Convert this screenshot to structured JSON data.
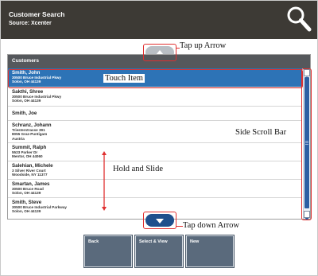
{
  "header": {
    "title": "Customer Search",
    "source": "Source: Xcenter",
    "search_icon": "search-icon"
  },
  "panel": {
    "title": "Customers"
  },
  "customers": [
    {
      "name": "Smith, John",
      "address": [
        "30500 Bruce Industrial Pkwy",
        "Solon, OH 44139"
      ],
      "selected": true
    },
    {
      "name": "Sakthi, Shree",
      "address": [
        "30500 Bruce Industrial Pkwy",
        "Solon, OH 44139"
      ],
      "selected": false
    },
    {
      "name": "Smith, Joe",
      "address": [],
      "selected": false
    },
    {
      "name": "Schranz, Johann",
      "address": [
        "Triesterstrasse 391",
        "8055 Graz-Puntigam",
        "Austria"
      ],
      "selected": false
    },
    {
      "name": "Summit, Ralph",
      "address": [
        "5523 Parker Dr",
        "Mentor, OH 44060"
      ],
      "selected": false
    },
    {
      "name": "Salehian, Michele",
      "address": [
        "3 Silver River Court",
        "Woodside, NY 11377"
      ],
      "selected": false
    },
    {
      "name": "Smartan, James",
      "address": [
        "30500 Bruce Road",
        "Solon, OH 44139"
      ],
      "selected": false
    },
    {
      "name": "Smith, Steve",
      "address": [
        "30500 Bruce Industrial Parkway",
        "Solon, OH 44139"
      ],
      "selected": false
    }
  ],
  "annotations": {
    "tap_up": "Tap up Arrow",
    "touch_item": "Touch Item",
    "side_scroll": "Side Scroll Bar",
    "hold_slide": "Hold and Slide",
    "tap_down": "Tap down Arrow"
  },
  "buttons": [
    {
      "label": "Back"
    },
    {
      "label": "Select & View"
    },
    {
      "label": "New"
    }
  ],
  "colors": {
    "header_bg": "#3d3a35",
    "selected_row": "#2d73b6",
    "button_bg": "#5a6a7c",
    "annotation_red": "#e03030"
  }
}
